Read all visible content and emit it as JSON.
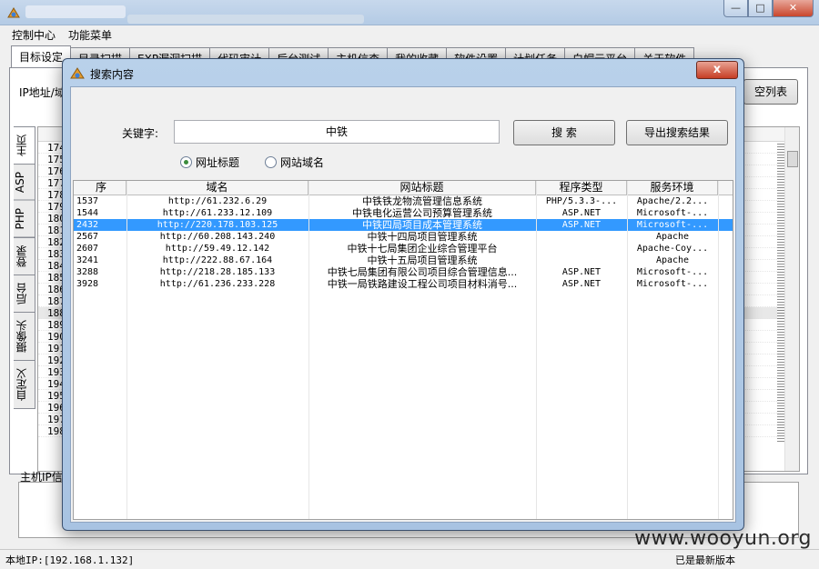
{
  "main_window": {
    "menu": [
      "控制中心",
      "功能菜单"
    ],
    "tabs": [
      "目标设定",
      "目录扫描",
      "EXP漏洞扫描",
      "代码审计",
      "后台测试",
      "主机信查",
      "我的收藏",
      "软件设置",
      "计划任务",
      "白帽云平台",
      "关于软件"
    ],
    "ip_label": "IP地址/域",
    "clear_button": "空列表",
    "side_tabs": [
      "主页",
      "ASP",
      "PHP",
      "登录",
      "后台",
      "摄像头",
      "自定义"
    ],
    "list_header": "序",
    "row_numbers": [
      "174",
      "175",
      "176",
      "177",
      "178",
      "179",
      "180",
      "181",
      "182",
      "183",
      "184",
      "185",
      "186",
      "187",
      "188",
      "189",
      "190",
      "191",
      "192",
      "193",
      "194",
      "195",
      "196",
      "197",
      "198"
    ],
    "host_info_label": "主机IP信",
    "status_ip": "本地IP:[192.168.1.132]",
    "status_version": "已是最新版本",
    "watermark": "www.wooyun.org"
  },
  "dialog": {
    "title": "搜索内容",
    "close_label": "x",
    "keyword_label": "关键字:",
    "keyword_value": "中铁",
    "search_button": "搜 索",
    "export_button": "导出搜索结果",
    "radio_options": [
      {
        "label": "网址标题",
        "selected": true
      },
      {
        "label": "网站域名",
        "selected": false
      }
    ],
    "columns": [
      "序",
      "域名",
      "网站标题",
      "程序类型",
      "服务环境"
    ],
    "rows": [
      {
        "id": "1537",
        "domain": "http://61.232.6.29",
        "title": "中铁铁龙物流管理信息系统",
        "type": "PHP/5.3.3-...",
        "server": "Apache/2.2...",
        "selected": false
      },
      {
        "id": "1544",
        "domain": "http://61.233.12.109",
        "title": "中铁电化运营公司预算管理系统",
        "type": "ASP.NET",
        "server": "Microsoft-...",
        "selected": false
      },
      {
        "id": "2432",
        "domain": "http://220.178.103.125",
        "title": "中铁四局项目成本管理系统",
        "type": "ASP.NET",
        "server": "Microsoft-...",
        "selected": true
      },
      {
        "id": "2567",
        "domain": "http://60.208.143.240",
        "title": "中铁十四局项目管理系统",
        "type": "",
        "server": "Apache",
        "selected": false
      },
      {
        "id": "2607",
        "domain": "http://59.49.12.142",
        "title": "中铁十七局集团企业综合管理平台",
        "type": "",
        "server": "Apache-Coy...",
        "selected": false
      },
      {
        "id": "3241",
        "domain": "http://222.88.67.164",
        "title": "中铁十五局项目管理系统",
        "type": "",
        "server": "Apache",
        "selected": false
      },
      {
        "id": "3288",
        "domain": "http://218.28.185.133",
        "title": "中铁七局集团有限公司项目综合管理信息...",
        "type": "ASP.NET",
        "server": "Microsoft-...",
        "selected": false
      },
      {
        "id": "3928",
        "domain": "http://61.236.233.228",
        "title": "中铁一局铁路建设工程公司项目材料消号...",
        "type": "ASP.NET",
        "server": "Microsoft-...",
        "selected": false
      }
    ]
  }
}
